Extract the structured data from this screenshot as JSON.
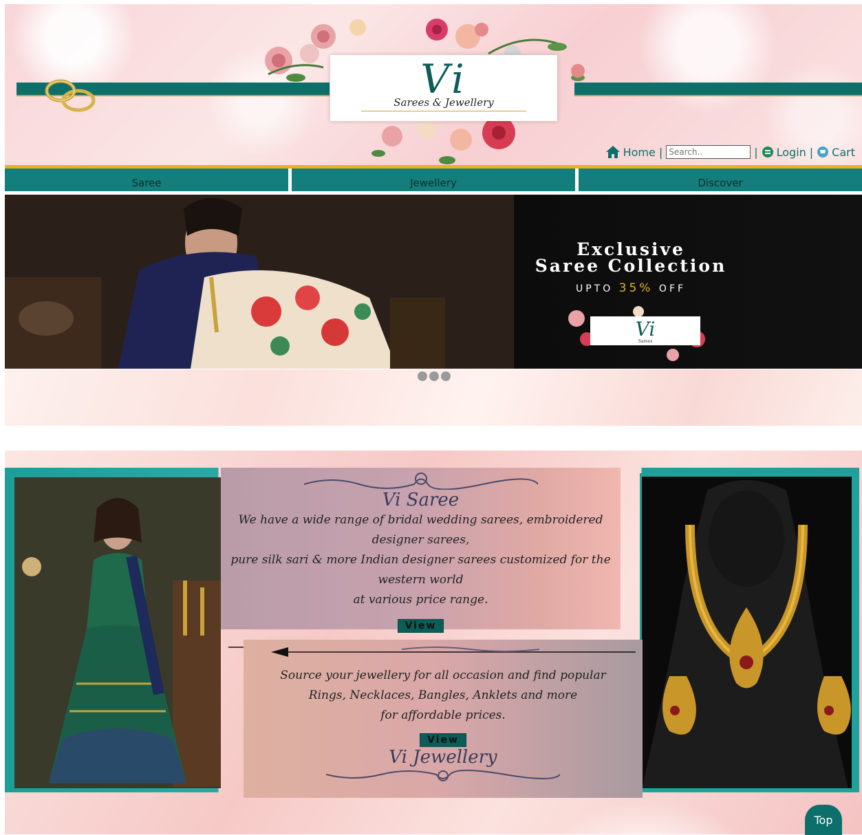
{
  "brand": {
    "logo_mark": "Vi",
    "logo_tagline": "Sarees & Jewellery",
    "teal": "#0d6f6b",
    "gold": "#e7b220"
  },
  "top_nav": {
    "home_label": "Home",
    "search_placeholder": "Search..",
    "login_label": "Login",
    "cart_label": "Cart",
    "separator": "|"
  },
  "categories": [
    {
      "label": "Saree"
    },
    {
      "label": "Jewellery"
    },
    {
      "label": "Discover"
    }
  ],
  "banner": {
    "line1": "Exclusive",
    "line2": "Saree Collection",
    "line3_prefix": "UPTO",
    "line3_pct": "35%",
    "line3_suffix": "OFF",
    "logo_mark": "Vi",
    "logo_sub": "Sarees",
    "slide_count": 3
  },
  "promo": {
    "saree": {
      "title": "Vi Saree",
      "body_line1": "We have a wide range of bridal wedding sarees, embroidered designer sarees,",
      "body_line2": "pure silk sari & more Indian designer sarees customized for the western world",
      "body_line3": "at various price range.",
      "button": "View"
    },
    "jewellery": {
      "title": "Vi Jewellery",
      "body_line1": "Source your jewellery for all occasion and find popular",
      "body_line2": "Rings, Necklaces, Bangles, Anklets and more",
      "body_line3": "for affordable prices.",
      "button": "View"
    }
  },
  "scroll_top": {
    "label": "Top"
  }
}
